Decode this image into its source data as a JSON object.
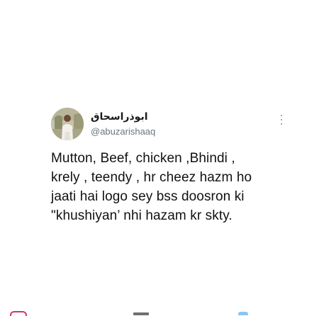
{
  "tweet": {
    "display_name": "ابوذراسحاق",
    "handle": "@abuzarishaaq",
    "text": "Mutton, Beef, chicken ,Bhindi ,\nkrely , teendy , hr cheez hazm ho\njaati hai logo sey bss doosron ki\n\"khushiyan’ nhi hazam kr skty."
  },
  "icons": {
    "avatar": "profile-photo",
    "more": "more-vertical-icon",
    "bottom_left": "instagram-icon",
    "bottom_center": "square-icon",
    "bottom_right": "twitter-icon"
  },
  "colors": {
    "background": "#ffffff",
    "text": "#111111",
    "handle": "#6b7580"
  }
}
